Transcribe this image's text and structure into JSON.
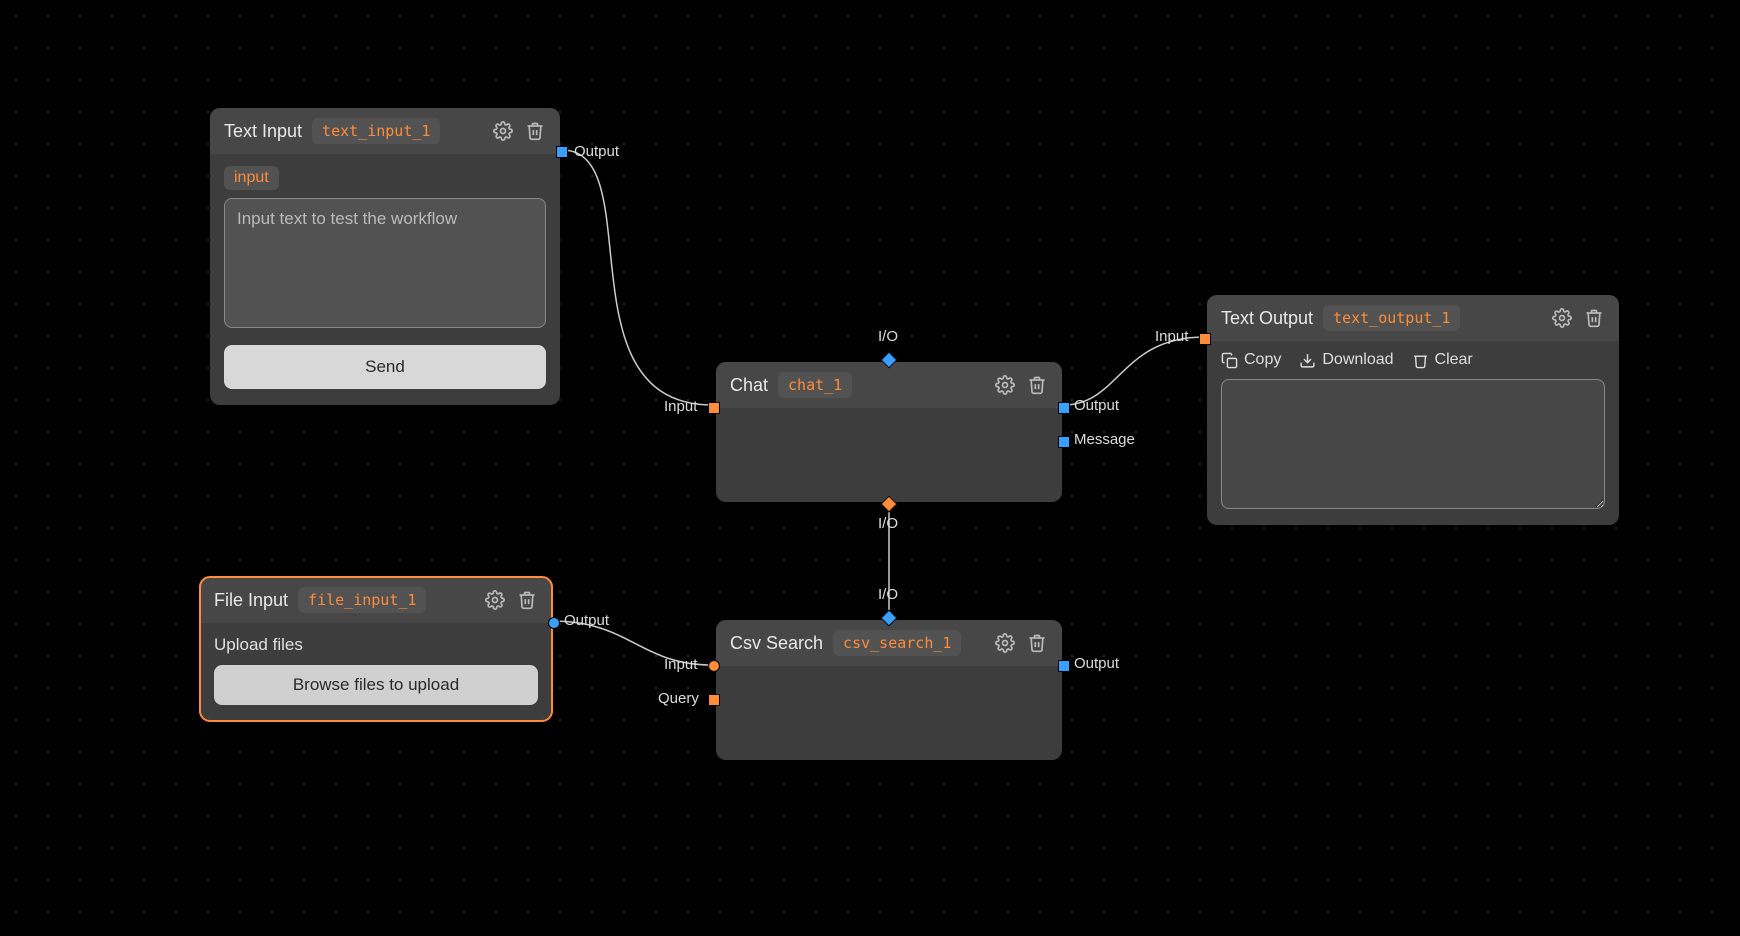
{
  "nodes": {
    "text_input": {
      "title": "Text Input",
      "id": "text_input_1",
      "input_pill": "input",
      "placeholder": "Input text to test the workflow",
      "send_label": "Send",
      "output_label": "Output"
    },
    "file_input": {
      "title": "File Input",
      "id": "file_input_1",
      "upload_label": "Upload files",
      "browse_label": "Browse files to upload",
      "output_label": "Output"
    },
    "chat": {
      "title": "Chat",
      "id": "chat_1",
      "input_label": "Input",
      "output_label": "Output",
      "message_label": "Message",
      "io_top_label": "I/O",
      "io_bottom_label": "I/O"
    },
    "csv_search": {
      "title": "Csv Search",
      "id": "csv_search_1",
      "input_label": "Input",
      "query_label": "Query",
      "output_label": "Output",
      "io_top_label": "I/O"
    },
    "text_output": {
      "title": "Text Output",
      "id": "text_output_1",
      "input_label": "Input",
      "copy_label": "Copy",
      "download_label": "Download",
      "clear_label": "Clear"
    }
  }
}
